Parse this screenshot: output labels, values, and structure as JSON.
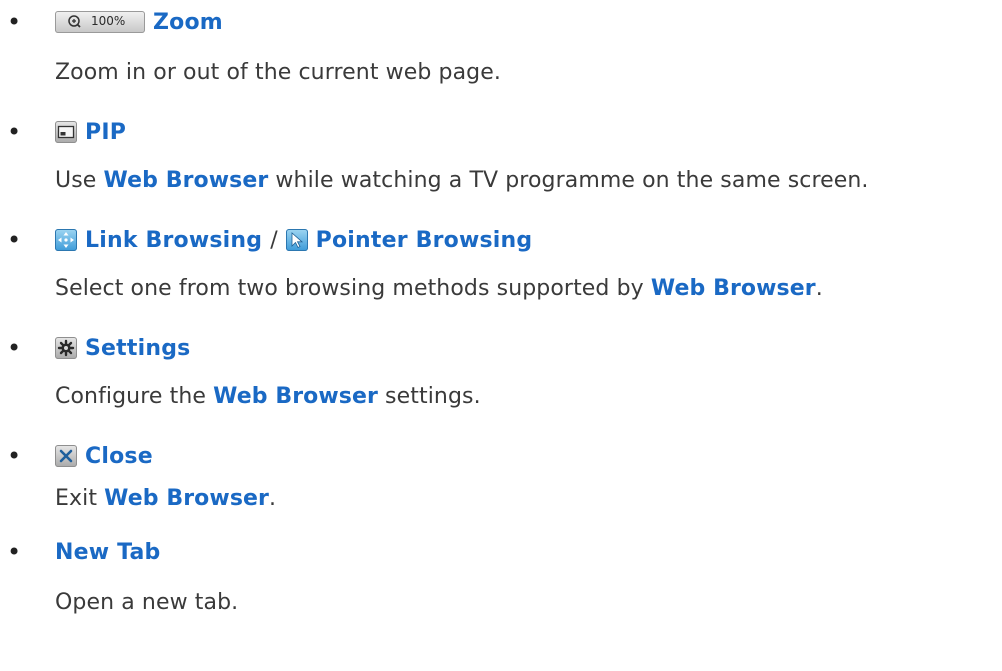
{
  "items": [
    {
      "icon": "zoom-icon",
      "zoom_level": "100%",
      "title": "Zoom",
      "desc": [
        {
          "t": "Zoom in or out of the current web page.",
          "hl": false
        }
      ]
    },
    {
      "icon": "pip-icon",
      "title": "PIP",
      "desc": [
        {
          "t": "Use ",
          "hl": false
        },
        {
          "t": "Web Browser",
          "hl": true
        },
        {
          "t": " while watching a TV programme on the same screen.",
          "hl": false
        }
      ]
    },
    {
      "icon": "link-browsing-icon",
      "title": "Link Browsing",
      "separator": "/",
      "icon2": "pointer-browsing-icon",
      "title2": "Pointer Browsing",
      "desc": [
        {
          "t": "Select one from two browsing methods supported by ",
          "hl": false
        },
        {
          "t": "Web Browser",
          "hl": true
        },
        {
          "t": ".",
          "hl": false
        }
      ]
    },
    {
      "icon": "gear-icon",
      "title": "Settings",
      "desc": [
        {
          "t": "Configure the ",
          "hl": false
        },
        {
          "t": "Web Browser",
          "hl": true
        },
        {
          "t": " settings.",
          "hl": false
        }
      ]
    },
    {
      "icon": "close-icon",
      "title": "Close",
      "desc": [
        {
          "t": "Exit ",
          "hl": false
        },
        {
          "t": "Web Browser",
          "hl": true
        },
        {
          "t": ".",
          "hl": false
        }
      ]
    },
    {
      "title": "New Tab",
      "desc": [
        {
          "t": "Open a new tab.",
          "hl": false
        }
      ]
    }
  ]
}
